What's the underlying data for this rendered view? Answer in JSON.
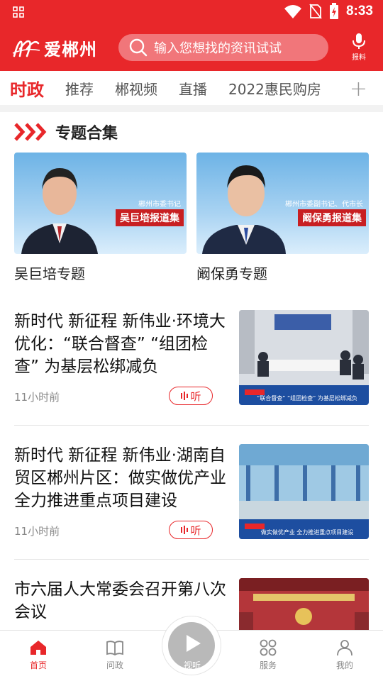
{
  "status": {
    "time": "8:33"
  },
  "app": {
    "name": "爱郴州",
    "mark": "chz"
  },
  "search": {
    "placeholder": "输入您想找的资讯试试"
  },
  "report": {
    "label": "报料"
  },
  "tabs": [
    "时政",
    "推荐",
    "郴视频",
    "直播",
    "2022惠民购房"
  ],
  "section": {
    "title": "专题合集"
  },
  "topics": [
    {
      "caption": "吴巨培专题",
      "badge": "吴巨培报道集",
      "badge_sub": "郴州市委书记"
    },
    {
      "caption": "阚保勇专题",
      "badge": "阚保勇报道集",
      "badge_sub": "郴州市委副书记、代市长"
    }
  ],
  "news": [
    {
      "headline": "新时代 新征程 新伟业·环境大优化：“联合督查” “组团检查” 为基层松绑减负",
      "time": "11小时前",
      "listen": "听",
      "thumb_caption": "“联合督查” “组团检查” 为基层松绑减负"
    },
    {
      "headline": "新时代 新征程 新伟业·湖南自贸区郴州片区：做实做优产业 全力推进重点项目建设",
      "time": "11小时前",
      "listen": "听",
      "thumb_caption": "做实做优产业 全力推进重点项目建设"
    },
    {
      "headline": "市六届人大常委会召开第八次会议",
      "time": "",
      "listen": ""
    }
  ],
  "nav": [
    {
      "label": "首页",
      "icon": "home-icon"
    },
    {
      "label": "问政",
      "icon": "book-icon"
    },
    {
      "label": "视听",
      "icon": "play-icon"
    },
    {
      "label": "服务",
      "icon": "grid-icon"
    },
    {
      "label": "我的",
      "icon": "person-icon"
    }
  ],
  "colors": {
    "brand": "#e8272a"
  }
}
